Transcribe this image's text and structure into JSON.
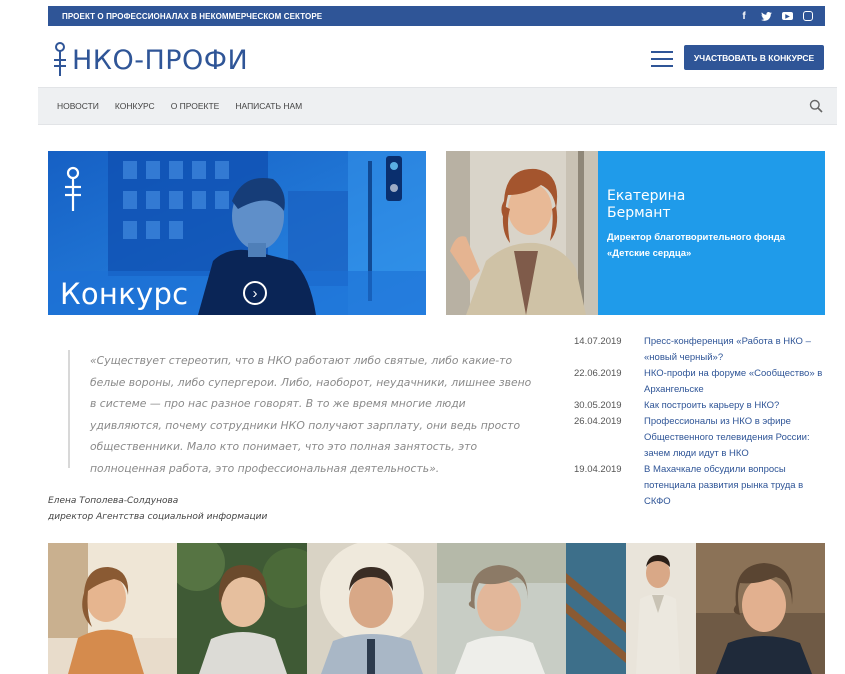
{
  "topbar": {
    "tagline": "ПРОЕКТ О ПРОФЕССИОНАЛАХ В НЕКОММЕРЧЕСКОМ СЕКТОРЕ",
    "social": [
      {
        "icon": "facebook-icon",
        "glyph": "f"
      },
      {
        "icon": "twitter-icon",
        "glyph": "🐦"
      },
      {
        "icon": "youtube-icon",
        "glyph": "▶"
      },
      {
        "icon": "instagram-icon",
        "glyph": "◎"
      }
    ]
  },
  "header": {
    "logo_text": "НКО-ПРОФИ",
    "cta_label": "УЧАСТВОВАТЬ В КОНКУРСЕ"
  },
  "nav": {
    "items": [
      "НОВОСТИ",
      "КОНКУРС",
      "О ПРОЕКТЕ",
      "НАПИСАТЬ НАМ"
    ]
  },
  "hero": {
    "contest_title": "Конкурс",
    "person_name_first": "Екатерина",
    "person_name_last": "Бермант",
    "person_role_line1": "Директор благотворительного фонда",
    "person_role_line2": "«Детские сердца»"
  },
  "quote": {
    "text": "«Существует стереотип, что в НКО работают либо святые, либо какие-то белые вороны, либо супергерои. Либо, наоборот, неудачники, лишнее звено в системе — про нас разное говорят. В то же время многие люди удивляются, почему сотрудники НКО получают зарплату, они ведь просто общественники. Мало кто понимает, что это полная занятость, это полноценная работа, это профессиональная деятельность».",
    "author_name": "Елена Тополева-Солдунова",
    "author_role": "директор Агентства социальной информации"
  },
  "news": [
    {
      "date": "14.07.2019",
      "title": "Пресс-конференция «Работа в НКО – «новый черный»?"
    },
    {
      "date": "22.06.2019",
      "title": "НКО-профи на форуме «Сообщество» в Архангельске"
    },
    {
      "date": "30.05.2019",
      "title": "Как построить карьеру в НКО?"
    },
    {
      "date": "26.04.2019",
      "title": "Профессионалы из НКО в эфире Общественного телевидения России: зачем люди идут в НКО"
    },
    {
      "date": "19.04.2019",
      "title": "В Махачкале обсудили вопросы потенциала развития рынка труда в СКФО"
    }
  ],
  "colors": {
    "brand": "#2f5597",
    "hero_blue": "#1f9bea",
    "nav_bg": "#eef0f2"
  }
}
